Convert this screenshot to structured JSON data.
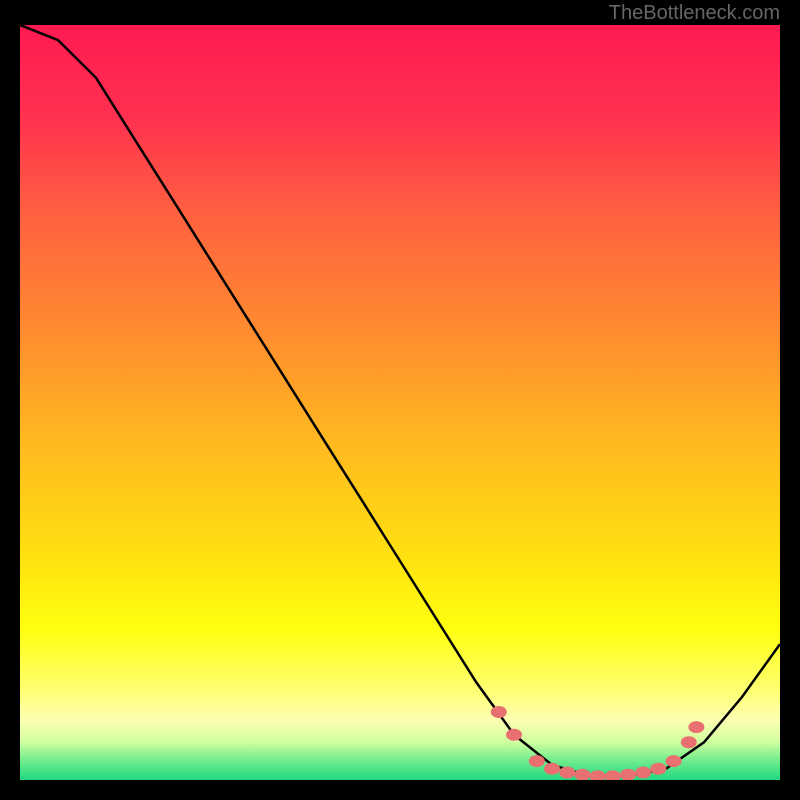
{
  "watermark": "TheBottleneck.com",
  "chart_data": {
    "type": "line",
    "title": "",
    "xlabel": "",
    "ylabel": "",
    "xlim": [
      0,
      100
    ],
    "ylim": [
      0,
      100
    ],
    "curve": [
      {
        "x": 0,
        "y": 100
      },
      {
        "x": 5,
        "y": 98
      },
      {
        "x": 10,
        "y": 93
      },
      {
        "x": 15,
        "y": 85
      },
      {
        "x": 20,
        "y": 77
      },
      {
        "x": 25,
        "y": 69
      },
      {
        "x": 30,
        "y": 61
      },
      {
        "x": 35,
        "y": 53
      },
      {
        "x": 40,
        "y": 45
      },
      {
        "x": 45,
        "y": 37
      },
      {
        "x": 50,
        "y": 29
      },
      {
        "x": 55,
        "y": 21
      },
      {
        "x": 60,
        "y": 13
      },
      {
        "x": 65,
        "y": 6
      },
      {
        "x": 70,
        "y": 2
      },
      {
        "x": 75,
        "y": 0.5
      },
      {
        "x": 80,
        "y": 0.5
      },
      {
        "x": 85,
        "y": 1.5
      },
      {
        "x": 90,
        "y": 5
      },
      {
        "x": 95,
        "y": 11
      },
      {
        "x": 100,
        "y": 18
      }
    ],
    "markers": [
      {
        "x": 63,
        "y": 9
      },
      {
        "x": 65,
        "y": 6
      },
      {
        "x": 68,
        "y": 2.5
      },
      {
        "x": 70,
        "y": 1.5
      },
      {
        "x": 72,
        "y": 1
      },
      {
        "x": 74,
        "y": 0.7
      },
      {
        "x": 76,
        "y": 0.5
      },
      {
        "x": 78,
        "y": 0.5
      },
      {
        "x": 80,
        "y": 0.7
      },
      {
        "x": 82,
        "y": 1
      },
      {
        "x": 84,
        "y": 1.5
      },
      {
        "x": 86,
        "y": 2.5
      },
      {
        "x": 88,
        "y": 5
      },
      {
        "x": 89,
        "y": 7
      }
    ],
    "gradient_stops": [
      {
        "offset": 0,
        "color": "#ff1a52"
      },
      {
        "offset": 12,
        "color": "#ff3050"
      },
      {
        "offset": 25,
        "color": "#ff6040"
      },
      {
        "offset": 40,
        "color": "#ff8a30"
      },
      {
        "offset": 55,
        "color": "#ffb820"
      },
      {
        "offset": 70,
        "color": "#ffe010"
      },
      {
        "offset": 80,
        "color": "#ffff10"
      },
      {
        "offset": 88,
        "color": "#feff70"
      },
      {
        "offset": 92,
        "color": "#fdffb0"
      },
      {
        "offset": 95,
        "color": "#d0ffa0"
      },
      {
        "offset": 97,
        "color": "#80f090"
      },
      {
        "offset": 100,
        "color": "#20d880"
      }
    ],
    "marker_color": "#e87070",
    "line_color": "#000000"
  }
}
